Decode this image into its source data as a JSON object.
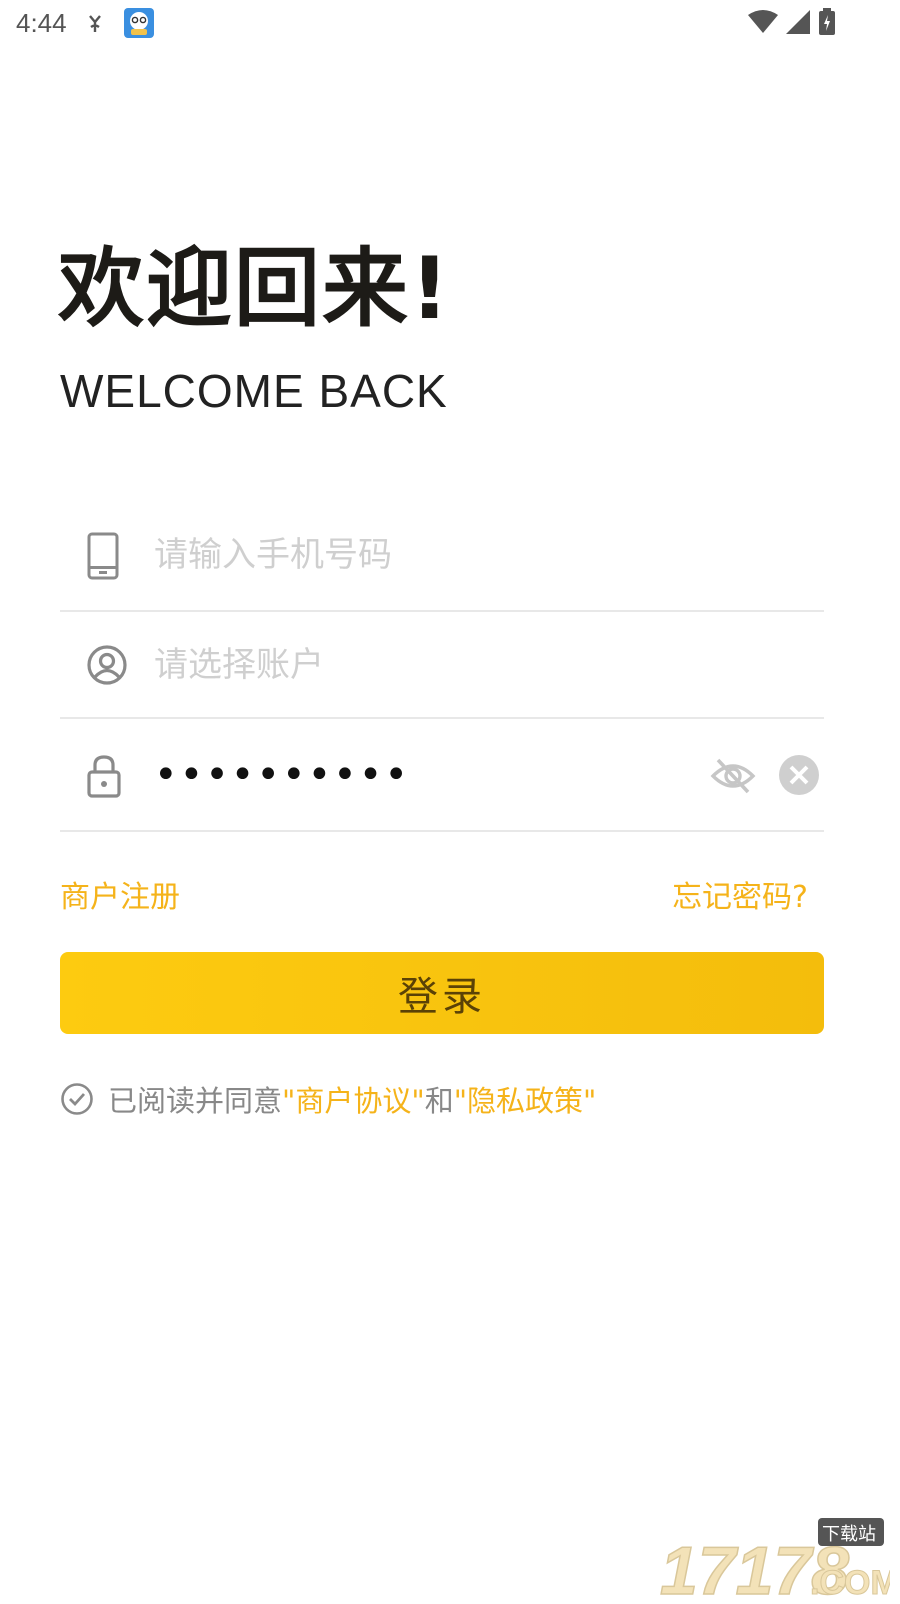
{
  "status_bar": {
    "time": "4:44"
  },
  "header": {
    "title": "欢迎回来!",
    "subtitle": "WELCOME BACK"
  },
  "form": {
    "phone_placeholder": "请输入手机号码",
    "account_placeholder": "请选择账户",
    "password_value": "••••••••••"
  },
  "links": {
    "register": "商户注册",
    "forgot_password": "忘记密码?"
  },
  "login_button": "登录",
  "agreement": {
    "prefix": "已阅读并同意",
    "merchant_agreement": "\"商户协议\"",
    "and": "和",
    "privacy_policy": "\"隐私政策\""
  },
  "watermark": {
    "number": "17178",
    "suffix": ".COM",
    "tag": "下载站"
  },
  "colors": {
    "accent": "#f5b31a",
    "button": "#fdcb10",
    "title": "#1d1b17"
  },
  "icons": [
    "phone-icon",
    "user-circle-icon",
    "lock-icon",
    "eye-off-icon",
    "clear-icon",
    "check-circle-icon",
    "wifi-icon",
    "signal-icon",
    "battery-icon"
  ]
}
